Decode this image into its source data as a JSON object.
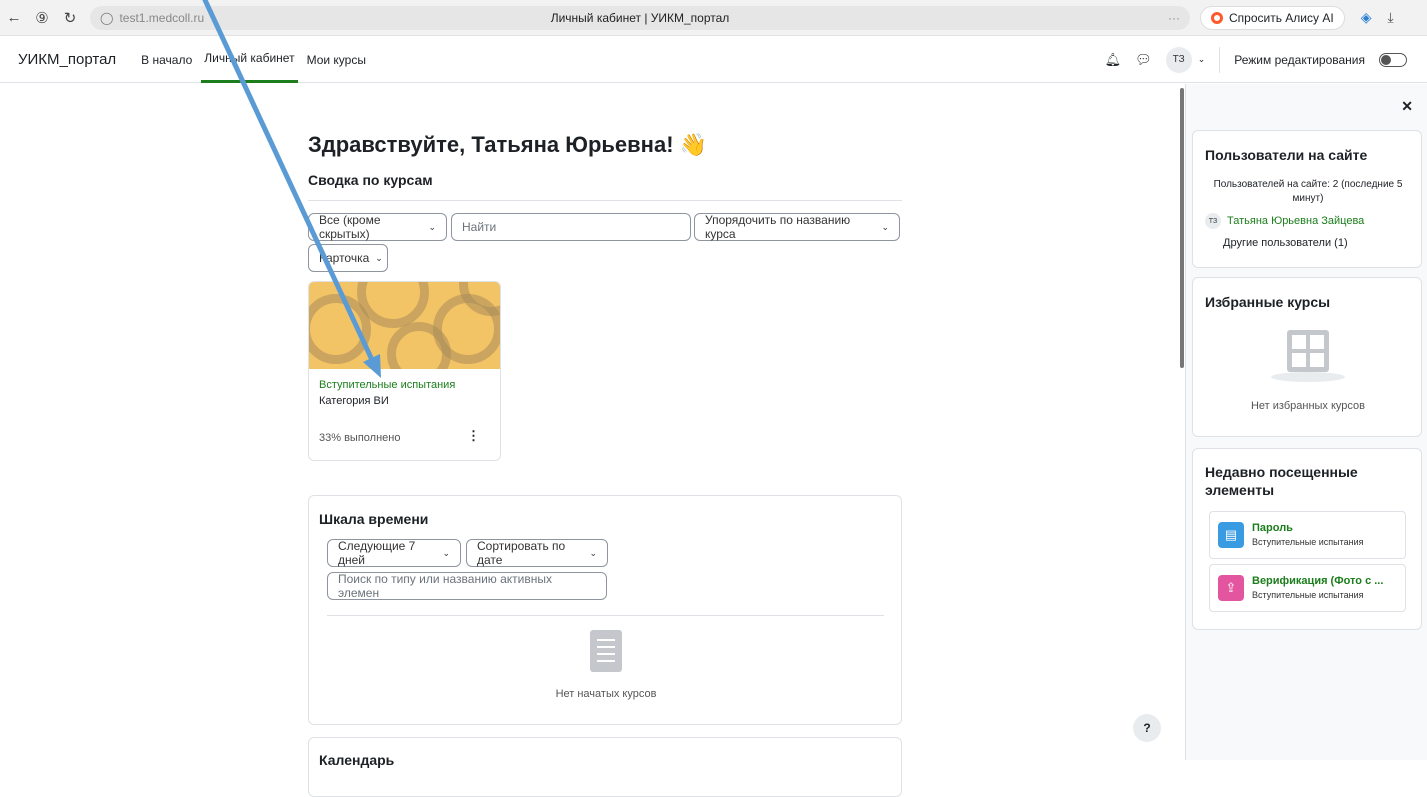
{
  "browser": {
    "url": "test1.medcoll.ru",
    "tab_title": "Личный кабинет | УИКМ_портал",
    "alice_label": "Спросить Алису AI",
    "more_dots": "···"
  },
  "navbar": {
    "brand": "УИКМ_портал",
    "links": [
      "В начало",
      "Личный кабинет",
      "Мои курсы"
    ],
    "active_index": 1,
    "user_initials": "ТЗ",
    "edit_mode_label": "Режим редактирования"
  },
  "main": {
    "greeting": "Здравствуйте, Татьяна Юрьевна! 👋",
    "overview_title": "Сводка по курсам",
    "filter_select": "Все (кроме скрытых)",
    "search_placeholder": "Найти",
    "sort_select": "Упорядочить по названию курса",
    "view_select": "Карточка",
    "course": {
      "title": "Вступительные испытания",
      "category": "Категория ВИ",
      "progress": "33% выполнено",
      "progress_value": 33
    }
  },
  "timeline": {
    "title": "Шкала времени",
    "range_select": "Следующие 7 дней",
    "sort_select": "Сортировать по дате",
    "search_placeholder": "Поиск по типу или названию активных элемен",
    "empty_text": "Нет начатых курсов"
  },
  "calendar": {
    "title": "Календарь"
  },
  "drawer": {
    "online_users": {
      "title": "Пользователи на сайте",
      "summary": "Пользователей на сайте: 2 (последние 5 минут)",
      "user_initials": "ТЗ",
      "user_name": "Татьяна Юрьевна Зайцева",
      "others": "Другие пользователи (1)"
    },
    "starred": {
      "title": "Избранные курсы",
      "empty_text": "Нет избранных курсов"
    },
    "recent": {
      "title": "Недавно посещенные элементы",
      "items": [
        {
          "title": "Пароль",
          "subtitle": "Вступительные испытания",
          "color": "#399be2"
        },
        {
          "title": "Верификация (Фото с ...",
          "subtitle": "Вступительные испытания",
          "color": "#e3559f"
        }
      ]
    }
  },
  "help_label": "?",
  "colors": {
    "accent_green": "#1b7d1b",
    "annotation_arrow": "#5b9bd5"
  }
}
